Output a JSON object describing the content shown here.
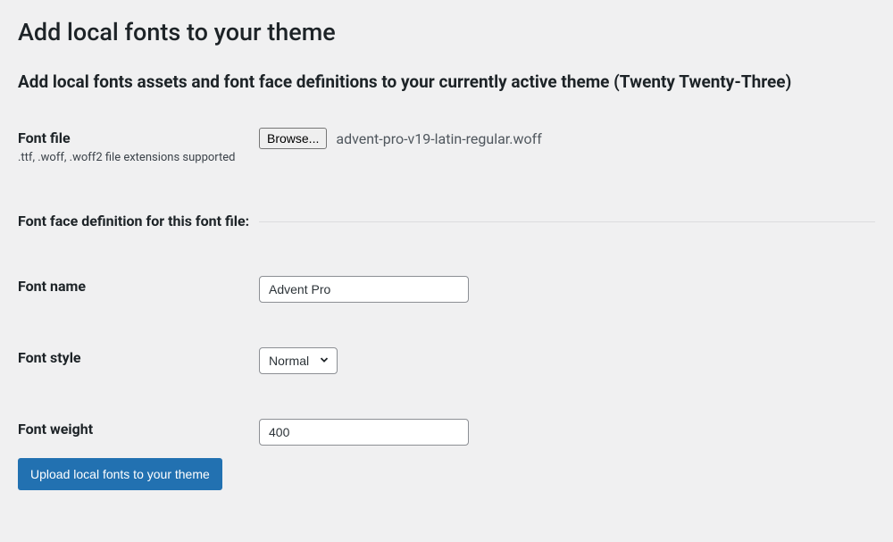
{
  "page_title": "Add local fonts to your theme",
  "subtitle": "Add local fonts assets and font face definitions to your currently active theme (Twenty Twenty-Three)",
  "font_file": {
    "label": "Font file",
    "hint": ".ttf, .woff, .woff2 file extensions supported",
    "browse_label": "Browse...",
    "selected_file": "advent-pro-v19-latin-regular.woff"
  },
  "section_label": "Font face definition for this font file:",
  "font_name": {
    "label": "Font name",
    "value": "Advent Pro"
  },
  "font_style": {
    "label": "Font style",
    "value": "Normal"
  },
  "font_weight": {
    "label": "Font weight",
    "value": "400"
  },
  "submit_label": "Upload local fonts to your theme"
}
